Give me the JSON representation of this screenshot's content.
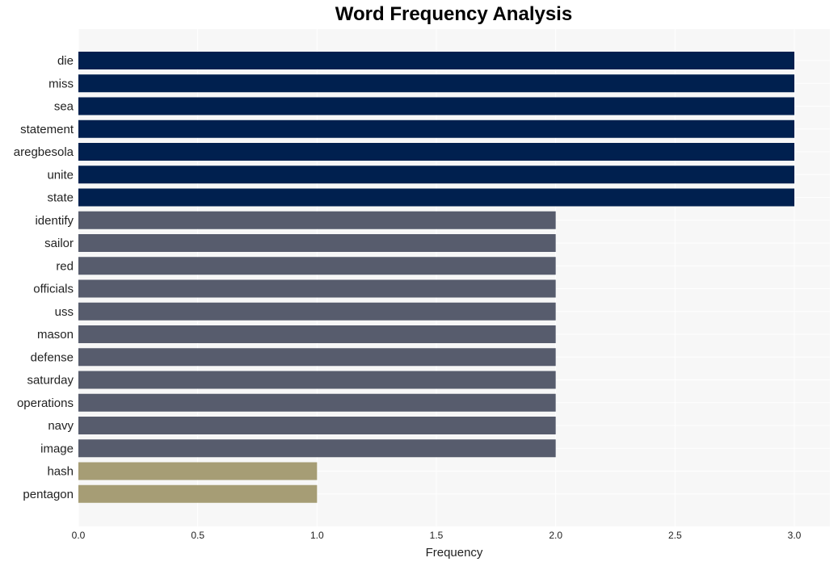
{
  "chart_data": {
    "type": "bar",
    "orientation": "horizontal",
    "title": "Word Frequency Analysis",
    "xlabel": "Frequency",
    "ylabel": "",
    "xlim": [
      0,
      3.15
    ],
    "xticks": [
      0.0,
      0.5,
      1.0,
      1.5,
      2.0,
      2.5,
      3.0
    ],
    "xtick_labels": [
      "0.0",
      "0.5",
      "1.0",
      "1.5",
      "2.0",
      "2.5",
      "3.0"
    ],
    "grid": true,
    "categories": [
      "die",
      "miss",
      "sea",
      "statement",
      "aregbesola",
      "unite",
      "state",
      "identify",
      "sailor",
      "red",
      "officials",
      "uss",
      "mason",
      "defense",
      "saturday",
      "operations",
      "navy",
      "image",
      "hash",
      "pentagon"
    ],
    "values": [
      3,
      3,
      3,
      3,
      3,
      3,
      3,
      2,
      2,
      2,
      2,
      2,
      2,
      2,
      2,
      2,
      2,
      2,
      1,
      1
    ],
    "colors_by_value": {
      "3": "#00204f",
      "2": "#575c6d",
      "1": "#a69d75"
    },
    "plot_background": "#f7f7f7",
    "grid_color": "#ffffff"
  }
}
